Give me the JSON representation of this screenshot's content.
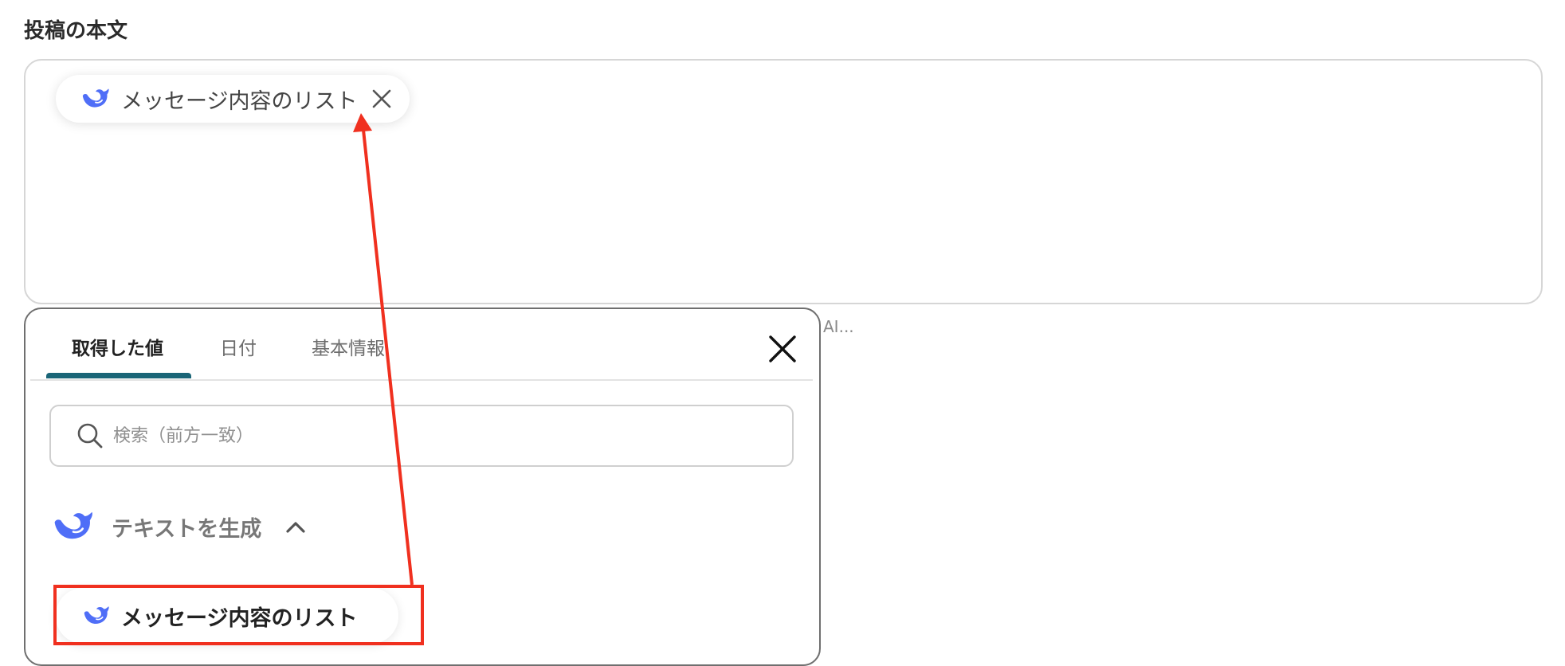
{
  "field": {
    "label": "投稿の本文",
    "chip_label": "メッセージ内容のリスト"
  },
  "hint_behind_panel": "AI...",
  "panel": {
    "tabs": [
      {
        "label": "取得した値",
        "active": true
      },
      {
        "label": "日付",
        "active": false
      },
      {
        "label": "基本情報",
        "active": false
      }
    ],
    "search_placeholder": "検索（前方一致）",
    "group": {
      "label": "テキストを生成",
      "expanded": true,
      "icon": "deepseek-whale-icon"
    },
    "items": [
      {
        "label": "メッセージ内容のリスト",
        "icon": "deepseek-whale-icon"
      }
    ]
  },
  "colors": {
    "tab_underline": "#1a6577",
    "whale": "#4f6ef7",
    "annotation": "#f0301f"
  }
}
